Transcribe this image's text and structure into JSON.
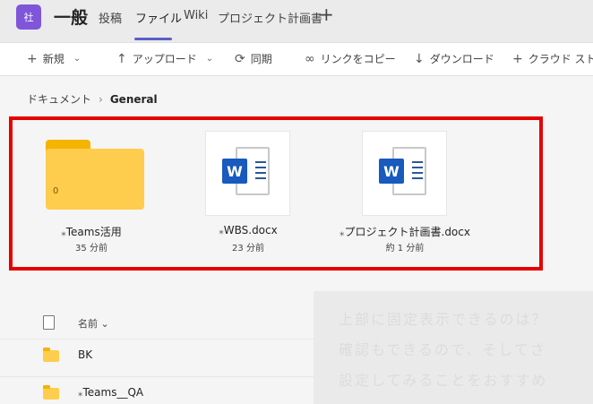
{
  "header": {
    "team_avatar": "社",
    "channel": "一般",
    "tabs": [
      "投稿",
      "ファイル",
      "Wiki",
      "プロジェクト計画書"
    ],
    "active_tab": "ファイル",
    "add_tab": "+"
  },
  "toolbar": {
    "new": "新規",
    "upload": "アップロード",
    "sync": "同期",
    "copy_link": "リンクをコピー",
    "download": "ダウンロード",
    "cloud": "クラウド ストレ"
  },
  "breadcrumb": {
    "root": "ドキュメント",
    "current": "General"
  },
  "tiles": [
    {
      "name": "Teams活用",
      "time": "35 分前",
      "type": "folder",
      "count": "0"
    },
    {
      "name": "WBS.docx",
      "time": "23 分前",
      "type": "word"
    },
    {
      "name": "プロジェクト計画書.docx",
      "time": "約 1 分前",
      "type": "word"
    }
  ],
  "list": {
    "col_name": "名前",
    "rows": [
      {
        "name": "BK"
      },
      {
        "name": "Teams__QA"
      }
    ]
  },
  "overlay": {
    "line1": "上部に固定表示できるのは？",
    "line2": "確認もできるので、そしてさ",
    "line3": "設定してみることをおすすめ"
  },
  "colors": {
    "accent": "#5b5fc7",
    "highlight_border": "#e60000",
    "word_blue": "#185abd",
    "folder": "#ffcd4d"
  }
}
